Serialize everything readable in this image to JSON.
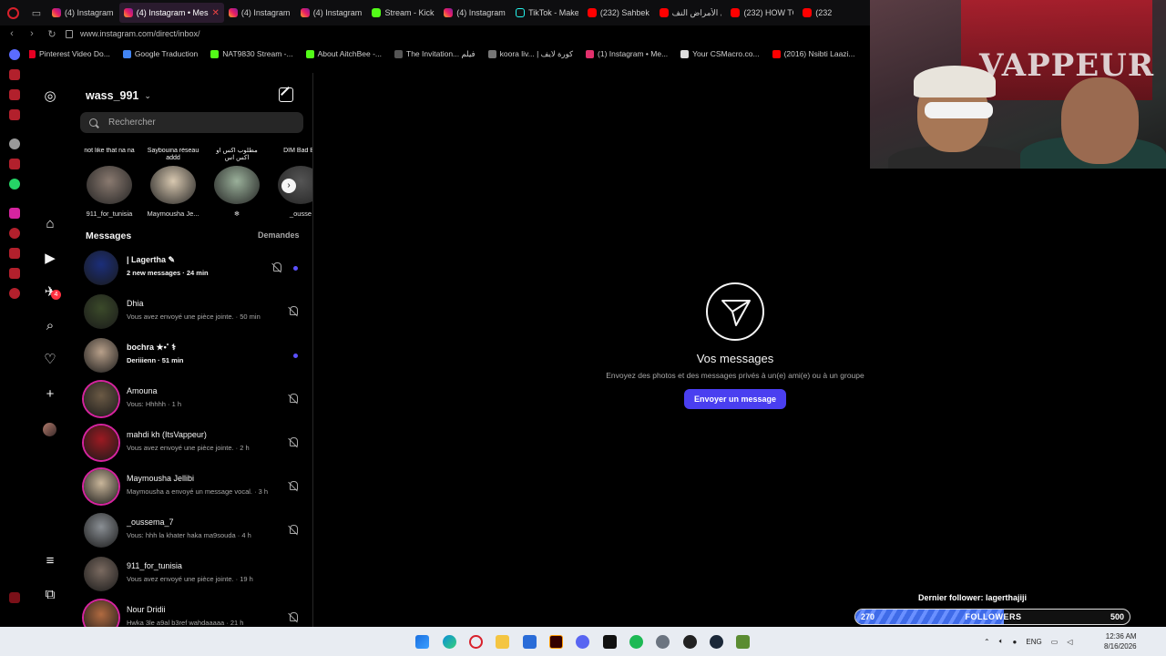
{
  "browser": {
    "tabs": [
      {
        "label": "(4) Instagram",
        "icon": "instagram",
        "active": false
      },
      {
        "label": "(4) Instagram • Mess",
        "icon": "instagram",
        "active": true
      },
      {
        "label": "(4) Instagram",
        "icon": "instagram",
        "active": false
      },
      {
        "label": "(4) Instagram",
        "icon": "instagram",
        "active": false
      },
      {
        "label": "Stream - Kick",
        "icon": "kick",
        "active": false
      },
      {
        "label": "(4) Instagram",
        "icon": "instagram",
        "active": false
      },
      {
        "label": "TikTok - Make",
        "icon": "tiktok",
        "active": false
      },
      {
        "label": "(232) Sahbek",
        "icon": "youtube",
        "active": false
      },
      {
        "label": "كل الأمراض النف",
        "icon": "youtube",
        "active": false
      },
      {
        "label": "(232) HOW TO",
        "icon": "youtube",
        "active": false
      },
      {
        "label": "(232",
        "icon": "youtube",
        "active": false
      }
    ],
    "url": "www.instagram.com/direct/inbox/",
    "bookmarks": [
      {
        "label": "Pinterest Video Do...",
        "color": "#e60023"
      },
      {
        "label": "Google Traduction",
        "color": "#4285f4"
      },
      {
        "label": "NAT9830 Stream -...",
        "color": "#53fc18"
      },
      {
        "label": "About AitchBee -...",
        "color": "#53fc18"
      },
      {
        "label": "The Invitation... فيلم",
        "color": "#555555"
      },
      {
        "label": "koora liv... | كورة لايف",
        "color": "#777777"
      },
      {
        "label": "(1) Instagram • Me...",
        "color": "#e1306c"
      },
      {
        "label": "Your CSMacro.co...",
        "color": "#dddddd"
      },
      {
        "label": "(2016) Nsibti Laazi...",
        "color": "#ff0000"
      }
    ]
  },
  "inbox": {
    "username": "wass_991",
    "search_placeholder": "Rechercher",
    "notes": [
      {
        "bubble": "not like that na na",
        "name": "911_for_tunisia"
      },
      {
        "bubble": "Saybouina réseau addd",
        "name": "Maymousha Je..."
      },
      {
        "bubble": "مطلوب اكس او اكس اس",
        "name": "❄"
      },
      {
        "bubble": "DIM Bad Ba",
        "name": "_ousse"
      }
    ],
    "messages_title": "Messages",
    "requests_label": "Demandes",
    "conversations": [
      {
        "name": "| Lagertha ✎",
        "preview": "2 new messages · 24 min",
        "unread": true,
        "muted": true,
        "ring": false,
        "avatar": "#1b2e7a"
      },
      {
        "name": "Dhia",
        "preview": "Vous avez envoyé une pièce jointe. · 50 min",
        "unread": false,
        "muted": true,
        "ring": false,
        "avatar": "#3b4a2a"
      },
      {
        "name": "bochra ★•˚ ⚕",
        "preview": "Deriiienn · 51 min",
        "unread": true,
        "muted": false,
        "ring": false,
        "avatar": "#b8a08a"
      },
      {
        "name": "Amouna",
        "preview": "Vous: Hhhhh · 1 h",
        "unread": false,
        "muted": true,
        "ring": true,
        "avatar": "#6b5a45"
      },
      {
        "name": "mahdi kh (ItsVappeur)",
        "preview": "Vous avez envoyé une pièce jointe. · 2 h",
        "unread": false,
        "muted": true,
        "ring": true,
        "avatar": "#9c1a22"
      },
      {
        "name": "Maymousha Jellibi",
        "preview": "Maymousha a envoyé un message vocal. · 3 h",
        "unread": false,
        "muted": true,
        "ring": true,
        "avatar": "#c9b69a"
      },
      {
        "name": "_oussema_7",
        "preview": "Vous: hhh la khater haka ma9souda · 4 h",
        "unread": false,
        "muted": true,
        "ring": false,
        "avatar": "#8a8f94"
      },
      {
        "name": "911_for_tunisia",
        "preview": "Vous avez envoyé une pièce jointe. · 19 h",
        "unread": false,
        "muted": false,
        "ring": false,
        "avatar": "#7a6a60"
      },
      {
        "name": "Nour Dridii",
        "preview": "Hwka 3le a9al b3ref wahdaaaaa · 21 h",
        "unread": false,
        "muted": true,
        "ring": true,
        "avatar": "#b06a40"
      }
    ]
  },
  "empty_state": {
    "title": "Vos messages",
    "subtitle": "Envoyez des photos et des messages privés à un(e) ami(e) ou à un groupe",
    "button": "Envoyer un message"
  },
  "webcam": {
    "wall_text": "VAPPEUR"
  },
  "follower_goal": {
    "label": "Dernier follower: lagerthajiji",
    "start": "270",
    "middle": "FOLLOWERS",
    "end": "500",
    "fill_fraction": 0.54
  },
  "taskbar": {
    "language": "ENG",
    "time": "12:36 AM",
    "date": "8/16/2026"
  }
}
